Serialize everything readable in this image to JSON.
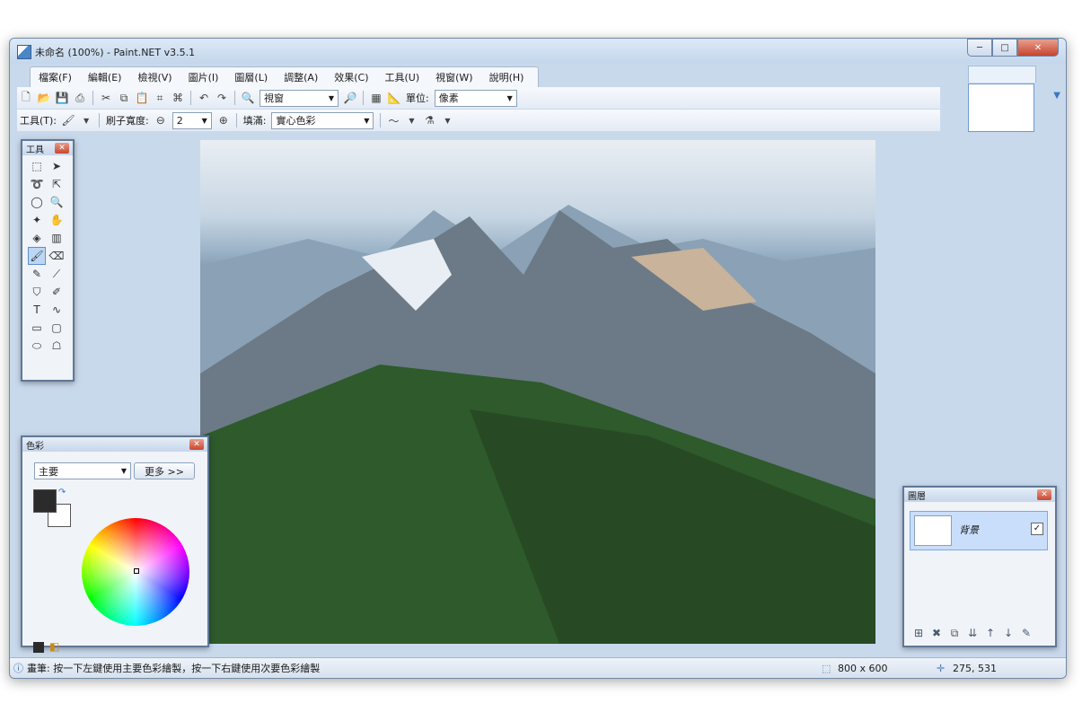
{
  "window": {
    "title": "未命名 (100%) - Paint.NET v3.5.1",
    "min": "─",
    "max": "□",
    "close": "✕"
  },
  "menu": [
    "檔案(F)",
    "編輯(E)",
    "檢視(V)",
    "圖片(I)",
    "圖層(L)",
    "調整(A)",
    "效果(C)",
    "工具(U)",
    "視窗(W)",
    "說明(H)"
  ],
  "toolbar1": {
    "zoom_value": "視窗",
    "units_label": "單位:",
    "units_value": "像素"
  },
  "toolbar2": {
    "tool_label": "工具(T):",
    "brush_width_label": "刷子寬度:",
    "brush_width_value": "2",
    "fill_label": "填滿:",
    "fill_value": "實心色彩"
  },
  "tools_panel": {
    "title": "工具"
  },
  "colors_panel": {
    "title": "色彩",
    "mode_value": "主要",
    "more_label": "更多 >>",
    "primary_color": "#2b2b2b",
    "secondary_color": "#ffffff"
  },
  "layers_panel": {
    "title": "圖層",
    "layer_name": "背景",
    "checked": "✓"
  },
  "status": {
    "hint": "畫筆: 按一下左鍵使用主要色彩繪製，按一下右鍵使用次要色彩繪製",
    "image_size": "800 x 600",
    "cursor_pos": "275, 531"
  }
}
